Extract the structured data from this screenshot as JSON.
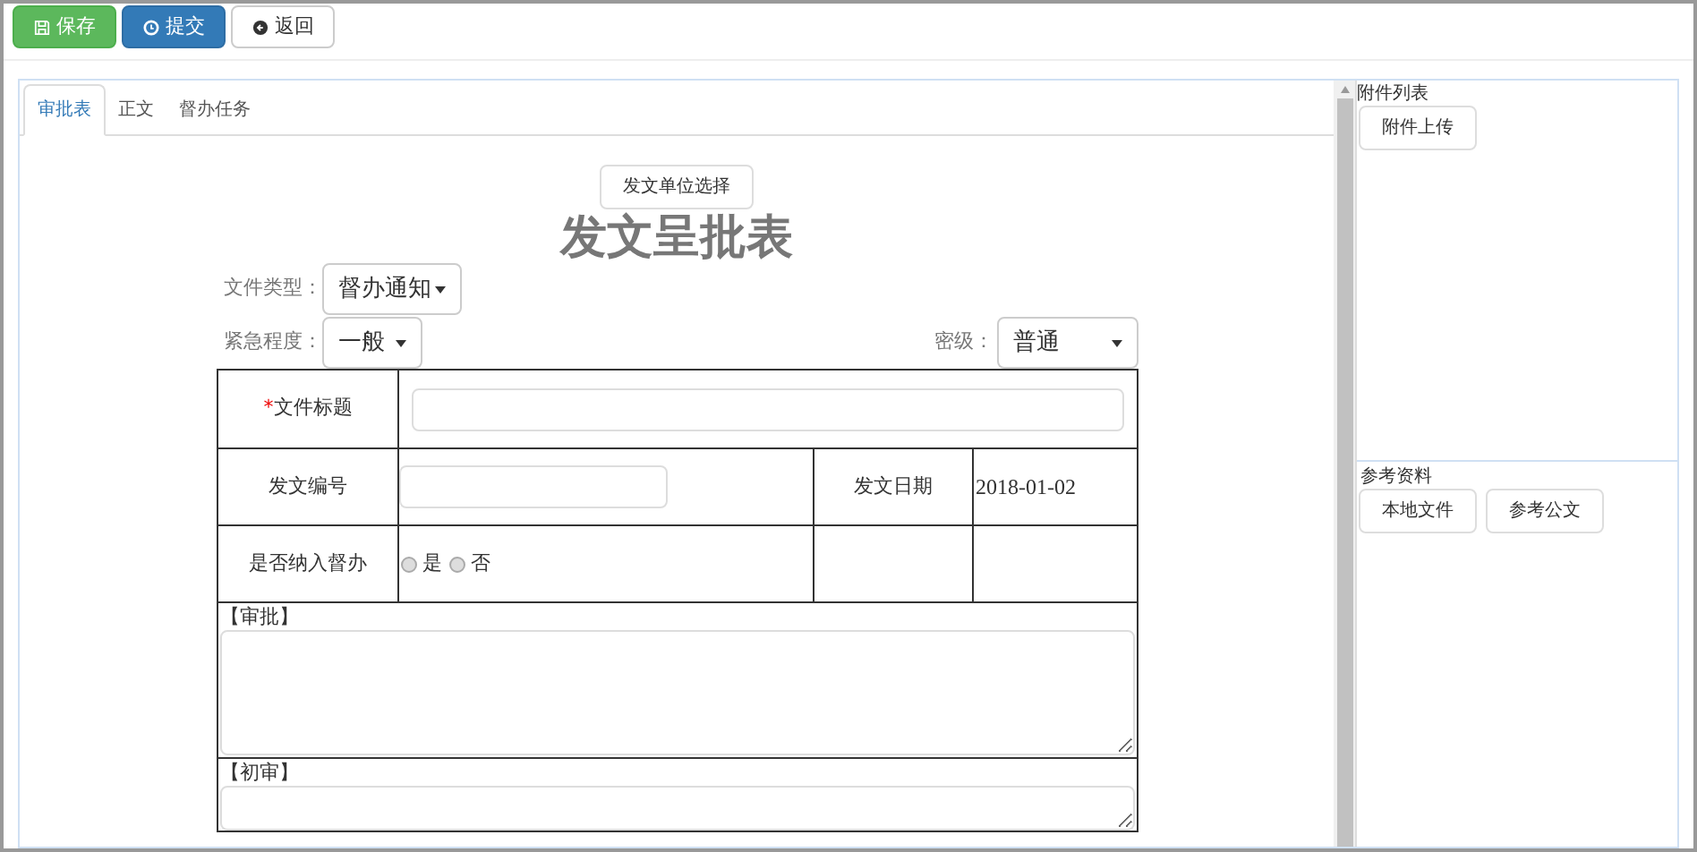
{
  "toolbar": [
    {
      "kind": "save",
      "label": "保存"
    },
    {
      "kind": "submit",
      "label": "提交"
    },
    {
      "kind": "back",
      "label": "返回"
    }
  ],
  "tabs": [
    {
      "label": "审批表",
      "selected": true
    },
    {
      "label": "正文",
      "selected": false
    },
    {
      "label": "督办任务",
      "selected": false
    }
  ],
  "unit_button": "发文单位选择",
  "form_title": "发文呈批表",
  "doc_type": {
    "label": "文件类型：",
    "value": "督办通知"
  },
  "urgency": {
    "label": "紧急程度：",
    "value": "一般"
  },
  "secrecy": {
    "label": "密级：",
    "value": "普通"
  },
  "table": {
    "title_label": {
      "mark": "*",
      "text": "文件标题"
    },
    "number_label": "发文编号",
    "date_label": "发文日期",
    "date_value": "2018-01-02",
    "supervise_label": "是否纳入督办",
    "supervise_options": [
      {
        "label": "是",
        "selected": false
      },
      {
        "label": "否",
        "selected": false
      }
    ],
    "sections": [
      "【审批】",
      "【初审】"
    ]
  },
  "attachments": {
    "title": "附件列表",
    "upload_button": "附件上传"
  },
  "references": {
    "title": "参考资料",
    "buttons": [
      "本地文件",
      "参考公文"
    ]
  }
}
